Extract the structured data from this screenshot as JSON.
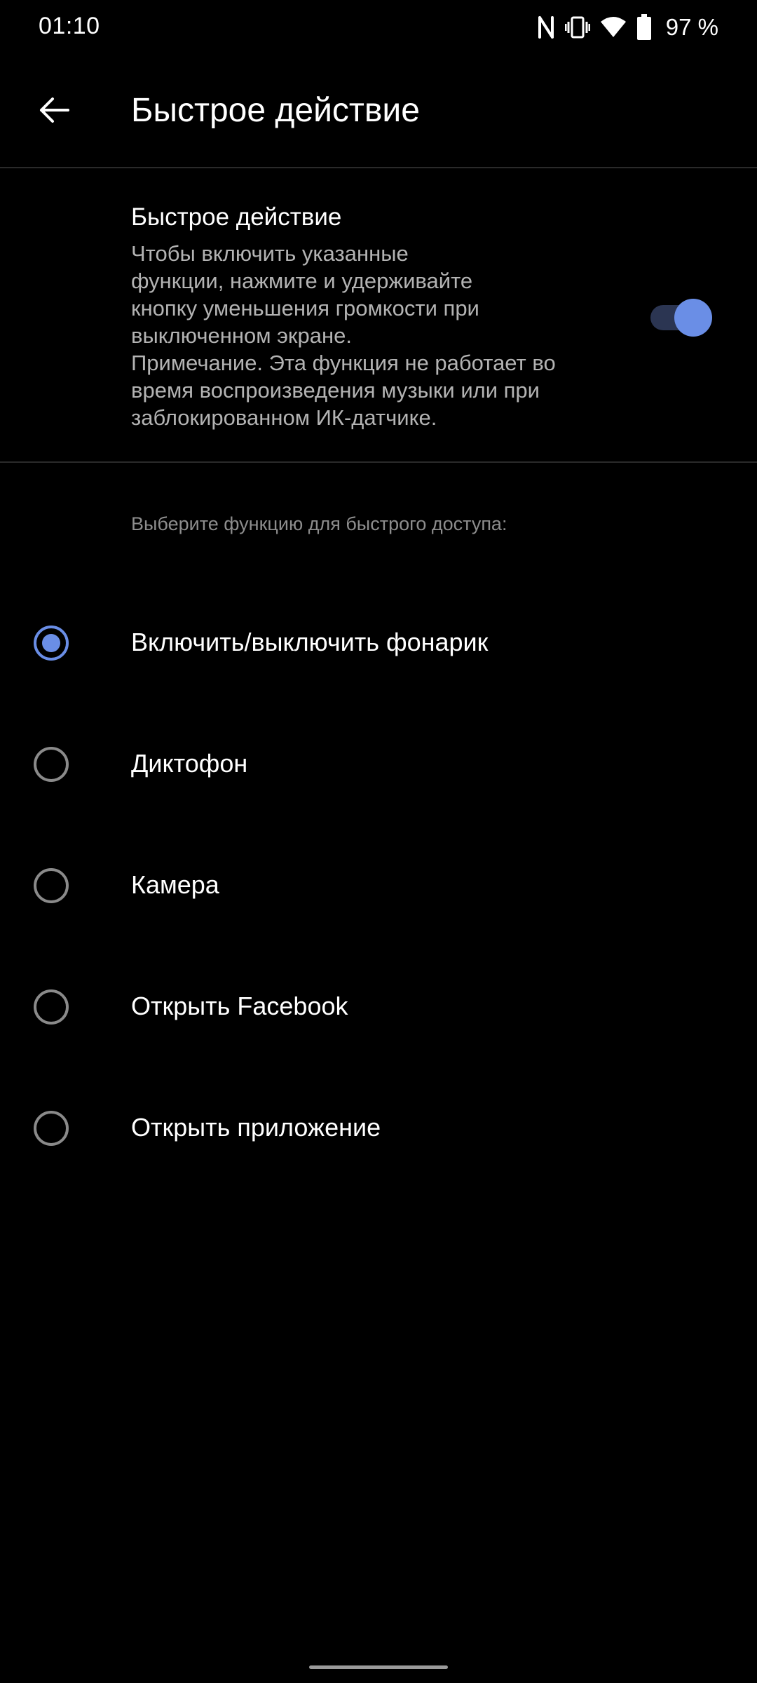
{
  "status_bar": {
    "time": "01:10",
    "battery_percent": "97 %",
    "icons": [
      "nfc-icon",
      "vibrate-icon",
      "wifi-icon",
      "battery-icon"
    ]
  },
  "header": {
    "title": "Быстрое действие",
    "back_icon": "arrow-back-icon"
  },
  "feature": {
    "title": "Быстрое действие",
    "description": "Чтобы включить указанные\nфункции, нажмите и удерживайте\nкнопку уменьшения громкости при\nвыключенном экране.\nПримечание. Эта функция не работает во\nвремя воспроизведения музыки или при\nзаблокированном ИК-датчике.",
    "enabled": true
  },
  "section": {
    "label": "Выберите функцию для быстрого доступа:"
  },
  "options": [
    {
      "label": "Включить/выключить фонарик",
      "selected": true
    },
    {
      "label": "Диктофон",
      "selected": false
    },
    {
      "label": "Камера",
      "selected": false
    },
    {
      "label": "Открыть Facebook",
      "selected": false
    },
    {
      "label": "Открыть приложение",
      "selected": false
    }
  ],
  "colors": {
    "accent": "#6a8ee6",
    "background": "#000000",
    "text_primary": "#ffffff",
    "text_secondary": "#b3b3b3"
  }
}
